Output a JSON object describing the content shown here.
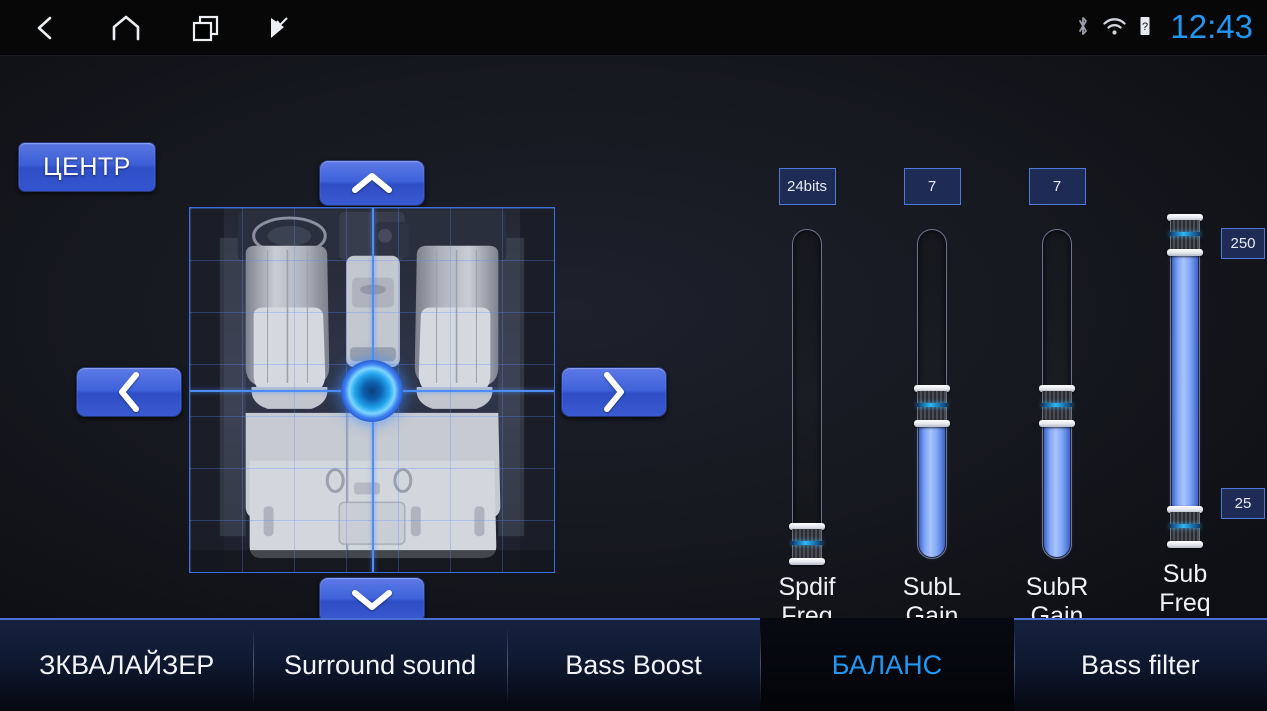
{
  "statusbar": {
    "nav": [
      {
        "name": "back-icon",
        "label": "Back"
      },
      {
        "name": "home-icon",
        "label": "Home"
      },
      {
        "name": "recents-icon",
        "label": "Recent apps"
      },
      {
        "name": "volume-flag-icon",
        "label": "Quick menu"
      }
    ],
    "icons": [
      {
        "name": "bluetooth-icon",
        "label": "Bluetooth"
      },
      {
        "name": "wifi-icon",
        "label": "Wi-Fi"
      },
      {
        "name": "battery-icon",
        "label": "Battery"
      }
    ],
    "clock": "12:43",
    "clock_color": "#2196f3"
  },
  "balance": {
    "center_button": "ЦЕНТР",
    "arrows": {
      "up": "chevron-up-icon",
      "down": "chevron-down-icon",
      "left": "chevron-left-icon",
      "right": "chevron-right-icon"
    }
  },
  "sliders": [
    {
      "id": "spdif-freq",
      "label_line1": "Spdif",
      "label_line2": "Freq",
      "value": "24bits",
      "fill_percent": 0,
      "thumb_percent": 0
    },
    {
      "id": "subl-gain",
      "label_line1": "SubL",
      "label_line2": "Gain",
      "value": "7",
      "fill_percent": 45,
      "thumb_percent": 45
    },
    {
      "id": "subr-gain",
      "label_line1": "SubR",
      "label_line2": "Gain",
      "value": "7",
      "fill_percent": 45,
      "thumb_percent": 45
    }
  ],
  "range_slider": {
    "id": "sub-freq",
    "label_line1": "Sub",
    "label_line2": "Freq",
    "upper_value": "250",
    "lower_value": "25",
    "upper_percent": 95,
    "lower_percent": 5
  },
  "tabs": [
    {
      "id": "tab-equalizer",
      "label": "ЗКВАЛАЙЗЕР",
      "active": false
    },
    {
      "id": "tab-surround-sound",
      "label": "Surround sound",
      "active": false
    },
    {
      "id": "tab-bass-boost",
      "label": "Bass Boost",
      "active": false
    },
    {
      "id": "tab-balance",
      "label": "БАЛАНС",
      "active": true
    },
    {
      "id": "tab-bass-filter",
      "label": "Bass filter",
      "active": false
    }
  ],
  "colors": {
    "accent": "#2196f3",
    "button_blue": "#3f62da",
    "grid_blue": "#3b6fe0",
    "panel_bg": "#16181f"
  }
}
